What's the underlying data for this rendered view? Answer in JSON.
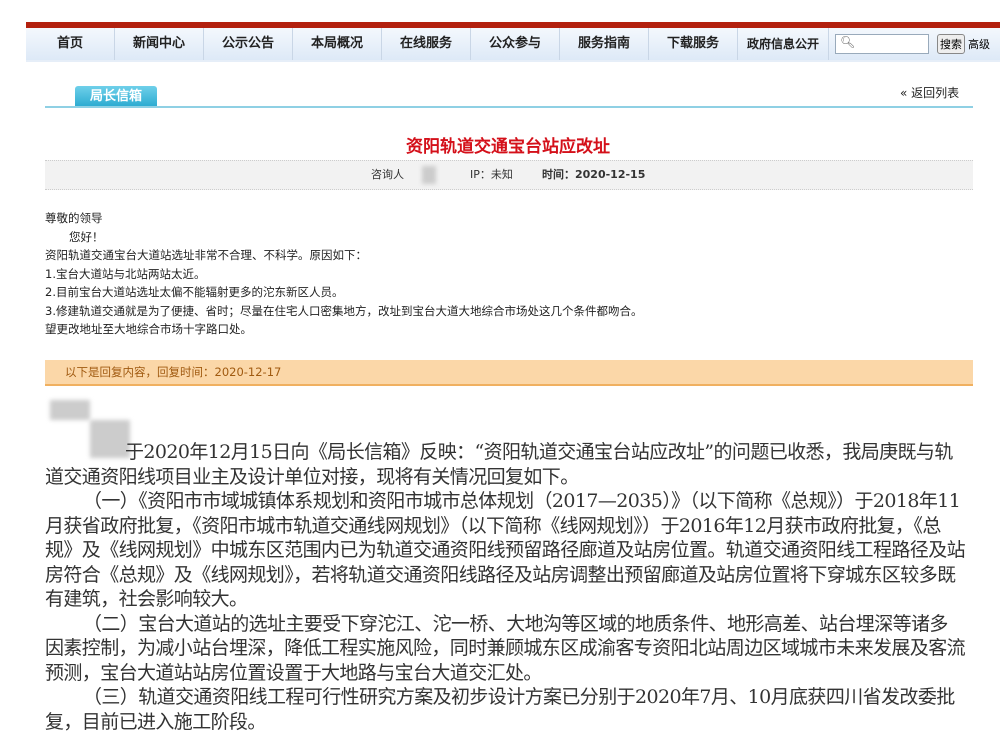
{
  "nav": {
    "items": [
      "首页",
      "新闻中心",
      "公示公告",
      "本局概况",
      "在线服务",
      "公众参与",
      "服务指南",
      "下载服务",
      "政府信息公开"
    ],
    "search_placeholder": "",
    "search_button": "搜索",
    "advanced": "高级"
  },
  "tab": "局长信箱",
  "back": "返回列表",
  "letter": {
    "title": "资阳轨道交通宝台站应改址",
    "asker_label": "咨询人",
    "ip": "IP：未知",
    "time": "时间：2020-12-15",
    "body": [
      "尊敬的领导",
      "您好！",
      "资阳轨道交通宝台大道站选址非常不合理、不科学。原因如下：",
      "1.宝台大道站与北站两站太近。",
      "2.目前宝台大道站选址太偏不能辐射更多的沱东新区人员。",
      "3.修建轨道交通就是为了便捷、省时；尽量在住宅人口密集地方，改址到宝台大道大地综合市场处这几个条件都吻合。",
      "望更改地址至大地综合市场十字路口处。"
    ]
  },
  "reply": {
    "header": "以下是回复内容，回复时间：2020-12-17",
    "paragraphs": [
      "于2020年12月15日向《局长信箱》反映：“资阳轨道交通宝台站应改址”的问题已收悉，我局庚既与轨道交通资阳线项目业主及设计单位对接，现将有关情况回复如下。",
      "（一）《资阳市市域城镇体系规划和资阳市城市总体规划（2017—2035）》（以下简称《总规》）于2018年11月获省政府批复，《资阳市城市轨道交通线网规划》（以下简称《线网规划》）于2016年12月获市政府批复，《总规》及《线网规划》中城东区范围内已为轨道交通资阳线预留路径廊道及站房位置。轨道交通资阳线工程路径及站房符合《总规》及《线网规划》，若将轨道交通资阳线路径及站房调整出预留廊道及站房位置将下穿城东区较多既有建筑，社会影响较大。",
      "（二）宝台大道站的选址主要受下穿沱江、沱一桥、大地沟等区域的地质条件、地形高差、站台埋深等诸多因素控制，为减小站台埋深，降低工程实施风险，同时兼顾城东区成渝客专资阳北站周边区域城市未来发展及客流预测，宝台大道站站房位置设置于大地路与宝台大道交汇处。",
      "（三）轨道交通资阳线工程可行性研究方案及初步设计方案已分别于2020年7月、10月底获四川省发改委批复，目前已进入施工阶段。"
    ]
  }
}
